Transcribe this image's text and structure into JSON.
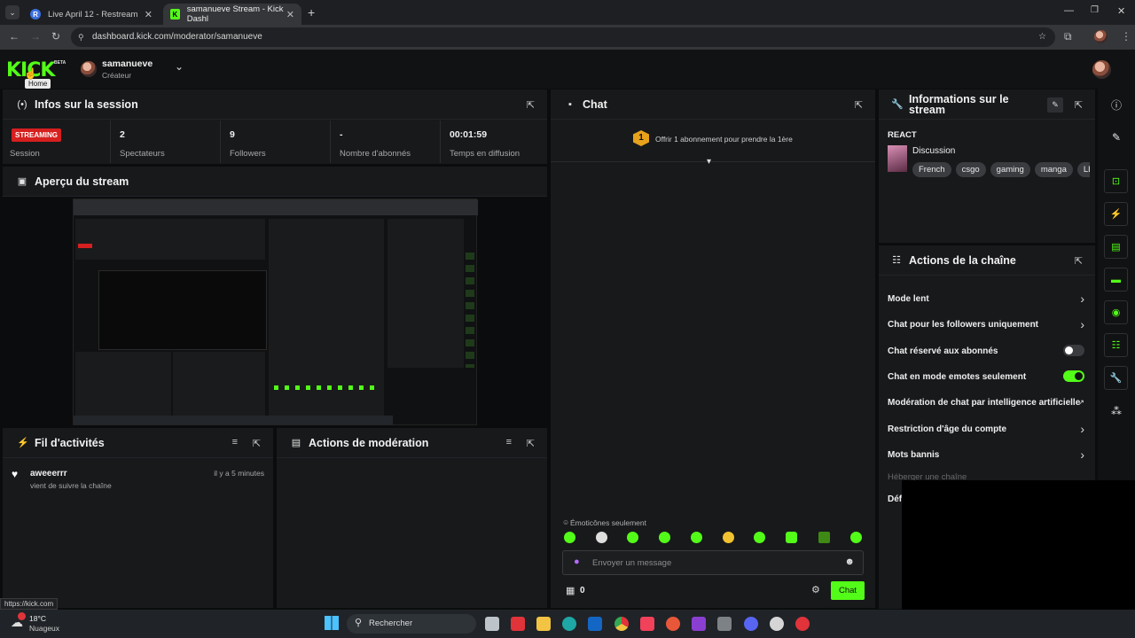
{
  "browser": {
    "tabs": [
      {
        "title": "Live April 12 - Restream",
        "active": false
      },
      {
        "title": "samanueve Stream - Kick Dashl",
        "active": true
      }
    ],
    "url": "dashboard.kick.com/moderator/samanueve",
    "status_url": "https://kick.com"
  },
  "header": {
    "logo": "KICK",
    "beta": "BETA",
    "tooltip": "Home",
    "user_name": "samanueve",
    "user_role": "Créateur"
  },
  "session": {
    "title": "Infos sur la session",
    "badge": "STREAMING",
    "badge_label": "Session",
    "stats": [
      {
        "value": "2",
        "label": "Spectateurs"
      },
      {
        "value": "9",
        "label": "Followers"
      },
      {
        "value": "-",
        "label": "Nombre d'abonnés"
      },
      {
        "value": "00:01:59",
        "label": "Temps en diffusion"
      }
    ]
  },
  "preview": {
    "title": "Aperçu du stream"
  },
  "activity": {
    "title": "Fil d'activités",
    "items": [
      {
        "user": "aweeerrr",
        "action": "vient de suivre la chaîne",
        "time": "il y a 5 minutes"
      }
    ]
  },
  "moderation": {
    "title": "Actions de modération"
  },
  "chat": {
    "title": "Chat",
    "sub_offer_count": "1",
    "sub_offer": "Offrir 1 abonnement pour prendre la 1ère",
    "emote_mode": "Émoticônes seulement",
    "placeholder": "Envoyer un message",
    "count": "0",
    "send_label": "Chat"
  },
  "stream_info": {
    "title": "Informations sur le stream",
    "category_prefix": "REACT",
    "category": "Discussion",
    "tags": [
      "French",
      "csgo",
      "gaming",
      "manga",
      "LE"
    ]
  },
  "channel_actions": {
    "title": "Actions de la chaîne",
    "items": [
      {
        "label": "Mode lent",
        "kind": "chevron"
      },
      {
        "label": "Chat pour les followers uniquement",
        "kind": "chevron"
      },
      {
        "label": "Chat réservé aux abonnés",
        "kind": "toggle",
        "on": false
      },
      {
        "label": "Chat en mode emotes seulement",
        "kind": "toggle",
        "on": true
      },
      {
        "label": "Modération de chat par intelligence artificielle",
        "kind": "external"
      },
      {
        "label": "Restriction d'âge du compte",
        "kind": "chevron"
      },
      {
        "label": "Mots bannis",
        "kind": "chevron"
      }
    ],
    "faded_item": "Héberger une chaîne",
    "cut_item": "Déf"
  },
  "taskbar": {
    "temperature": "18°C",
    "weather": "Nuageux",
    "search": "Rechercher"
  },
  "colors": {
    "accent": "#53fc18",
    "live": "#d61f1f",
    "panel": "#18191b"
  }
}
